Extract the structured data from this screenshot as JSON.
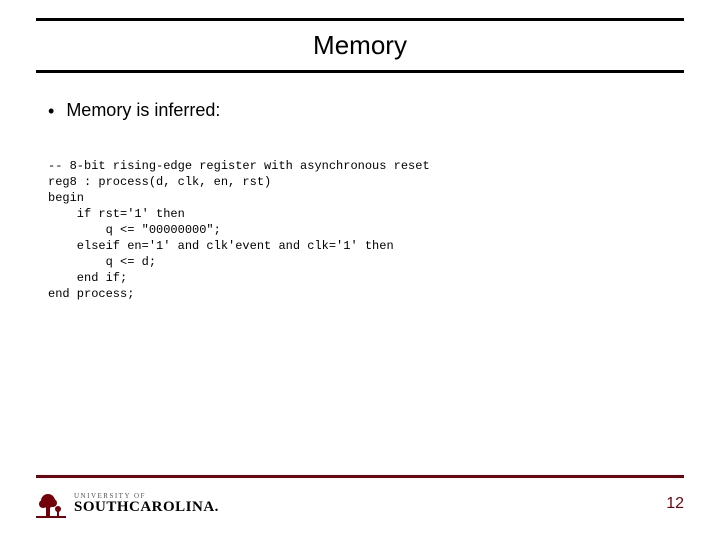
{
  "title": "Memory",
  "bullet": "Memory is inferred:",
  "code": "-- 8-bit rising-edge register with asynchronous reset\nreg8 : process(d, clk, en, rst)\nbegin\n    if rst='1' then\n        q <= \"00000000\";\n    elseif en='1' and clk'event and clk='1' then\n        q <= d;\n    end if;\nend process;",
  "footer": {
    "univ_label": "UNIVERSITY OF",
    "sc_label": "SOUTHCAROLINA.",
    "pagenum": "12"
  }
}
